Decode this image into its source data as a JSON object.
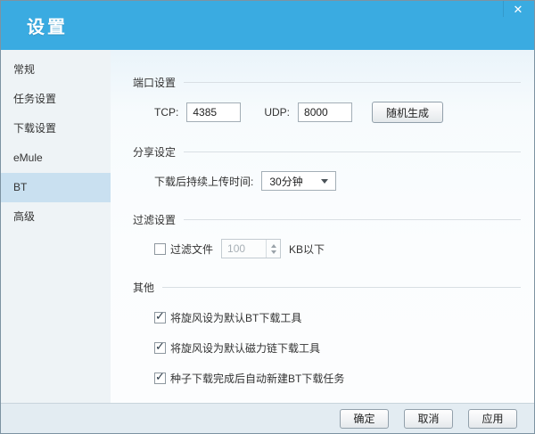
{
  "window": {
    "title": "设置",
    "close_glyph": "✕"
  },
  "sidebar": {
    "selected": "BT",
    "items": [
      {
        "label": "常规"
      },
      {
        "label": "任务设置"
      },
      {
        "label": "下载设置"
      },
      {
        "label": "eMule"
      },
      {
        "label": "BT"
      },
      {
        "label": "高级"
      }
    ]
  },
  "sections": {
    "port": {
      "title": "端口设置",
      "tcp_label": "TCP:",
      "tcp_value": "4385",
      "udp_label": "UDP:",
      "udp_value": "8000",
      "random_button": "随机生成"
    },
    "share": {
      "title": "分享设定",
      "upload_time_label": "下载后持续上传时间:",
      "upload_time_value": "30分钟"
    },
    "filter": {
      "title": "过滤设置",
      "checkbox_label": "过滤文件",
      "checkbox_checked": false,
      "size_value": "100",
      "unit_label": "KB以下"
    },
    "other": {
      "title": "其他",
      "checkboxes": [
        {
          "label": "将旋风设为默认BT下载工具",
          "checked": true
        },
        {
          "label": "将旋风设为默认磁力链下载工具",
          "checked": true
        },
        {
          "label": "种子下载完成后自动新建BT下载任务",
          "checked": true
        }
      ]
    }
  },
  "footer": {
    "ok": "确定",
    "cancel": "取消",
    "apply": "应用"
  },
  "icons": {
    "check": "✓"
  },
  "colors": {
    "header_blue": "#3aabe1",
    "sidebar_bg": "#eef3f6",
    "sidebar_selected_bg": "#c9e0f0",
    "content_bg": "#fbfdfe",
    "footer_bg": "#e3ecf2",
    "section_line": "#d9dfe4",
    "input_border": "#a3aeb6",
    "disabled_text": "#a8b0b6"
  }
}
